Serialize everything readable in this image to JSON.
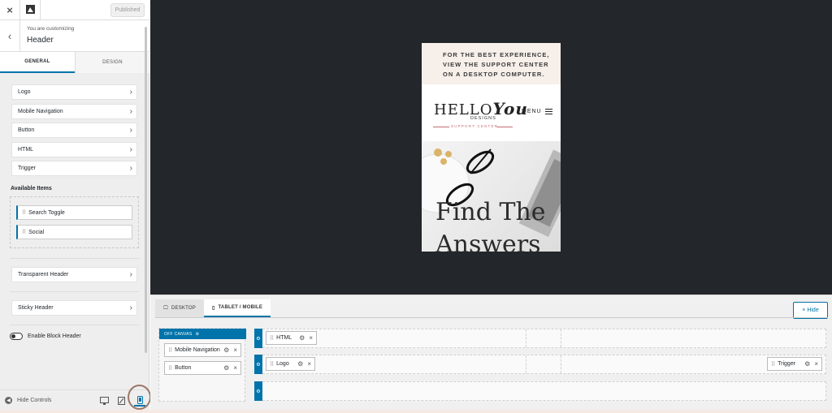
{
  "topbar": {
    "close": "×",
    "publish_label": "Published"
  },
  "customizing": {
    "subtitle": "You are customizing",
    "title": "Header",
    "back": "‹"
  },
  "tabs": [
    {
      "label": "GENERAL"
    },
    {
      "label": "DESIGN"
    }
  ],
  "sections": [
    {
      "label": "Logo"
    },
    {
      "label": "Mobile Navigation"
    },
    {
      "label": "Button"
    },
    {
      "label": "HTML"
    },
    {
      "label": "Trigger"
    }
  ],
  "available": {
    "label": "Available Items",
    "items": [
      {
        "label": "Search Toggle"
      },
      {
        "label": "Social"
      }
    ]
  },
  "extra_sections": [
    {
      "label": "Transparent Header"
    },
    {
      "label": "Sticky Header"
    }
  ],
  "toggle": {
    "label": "Enable Block Header",
    "on": false
  },
  "bottombar": {
    "hide_controls": "Hide Controls",
    "active_device": "mobile"
  },
  "preview": {
    "notice": [
      "FOR THE BEST EXPERIENCE,",
      "VIEW THE SUPPORT CENTER",
      "ON A DESKTOP COMPUTER."
    ],
    "logo": {
      "hello": "HELLO",
      "you": "You",
      "designs": "DESIGNS",
      "support": "SUPPORT CENTER"
    },
    "menu": "MENU",
    "hero": [
      "Find The",
      "Answers"
    ]
  },
  "builder": {
    "tabs": [
      {
        "label": "DESKTOP"
      },
      {
        "label": "TABLET / MOBILE"
      }
    ],
    "hide_label": "Hide",
    "off_canvas": {
      "label": "OFF CANVAS",
      "items": [
        {
          "label": "Mobile Navigation"
        },
        {
          "label": "Button"
        }
      ]
    },
    "rows": [
      {
        "left_item": "HTML",
        "right_item": ""
      },
      {
        "left_item": "Logo",
        "right_item": "Trigger"
      },
      {
        "left_item": "",
        "right_item": ""
      }
    ]
  },
  "colors": {
    "accent": "#0073aa",
    "preview_bg": "#23272b",
    "notice_bg": "#f6efea",
    "brand_pink": "#c26d70"
  }
}
